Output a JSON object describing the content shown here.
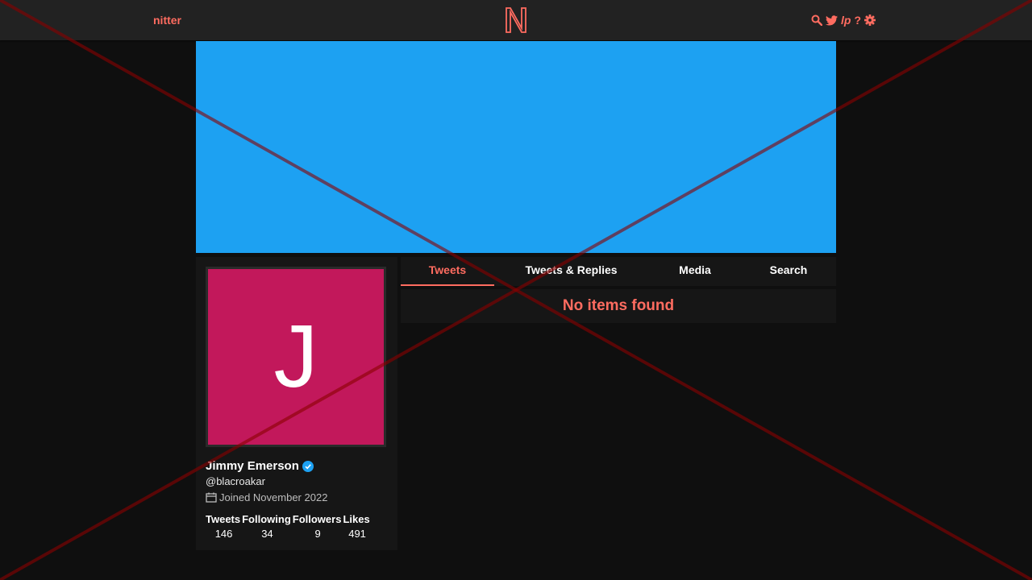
{
  "navbar": {
    "brand": "nitter",
    "logo_letter": "N",
    "icons": [
      "search-icon",
      "twitter-bird-icon",
      "lp-icon",
      "help-icon",
      "gear-icon"
    ],
    "lp_label": "lp",
    "help_label": "?"
  },
  "banner": {
    "color": "#1da1f2"
  },
  "profile": {
    "avatar_letter": "J",
    "avatar_color": "#c2185b",
    "fullname": "Jimmy Emerson",
    "verified": true,
    "username": "@blacroakar",
    "joined": "Joined November 2022",
    "stats": [
      {
        "label": "Tweets",
        "value": "146"
      },
      {
        "label": "Following",
        "value": "34"
      },
      {
        "label": "Followers",
        "value": "9"
      },
      {
        "label": "Likes",
        "value": "491"
      }
    ]
  },
  "tabs": [
    {
      "label": "Tweets",
      "active": true
    },
    {
      "label": "Tweets & Replies",
      "active": false
    },
    {
      "label": "Media",
      "active": false
    },
    {
      "label": "Search",
      "active": false
    }
  ],
  "timeline": {
    "empty_message": "No items found"
  },
  "colors": {
    "accent": "#ff6c60",
    "overlay_x": "#8b0000"
  }
}
